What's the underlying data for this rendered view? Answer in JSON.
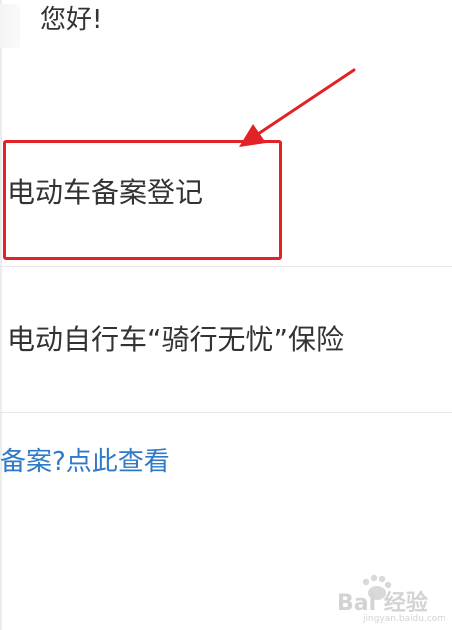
{
  "greeting": "您好!",
  "options": [
    {
      "label": "电动车备案登记"
    },
    {
      "label": "电动自行车“骑行无忧”保险"
    }
  ],
  "help_link": "备案?点此查看",
  "annotation": {
    "highlight_color": "#e32228"
  },
  "watermark": {
    "brand": "Bai 经验",
    "domain": "jingyan.baidu.com"
  }
}
